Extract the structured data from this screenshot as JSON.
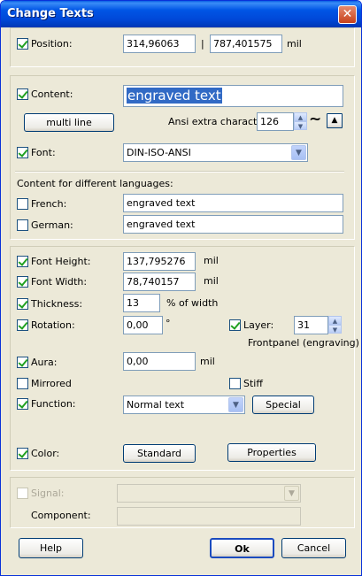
{
  "window": {
    "title": "Change Texts"
  },
  "position": {
    "label": "Position:",
    "x": "314,96063",
    "separator": "|",
    "y": "787,401575",
    "unit": "mil"
  },
  "content": {
    "label": "Content:",
    "value": "engraved text",
    "multiline_label": "multi line",
    "ansi_label": "Ansi extra character:",
    "ansi_value": "126",
    "tilde": "~",
    "font_label": "Font:",
    "font_value": "DIN-ISO-ANSI",
    "languages_label": "Content for different languages:",
    "french_label": "French:",
    "french_value": "engraved text",
    "german_label": "German:",
    "german_value": "engraved text"
  },
  "format": {
    "font_height_label": "Font Height:",
    "font_height": "137,795276",
    "font_height_unit": "mil",
    "font_width_label": "Font Width:",
    "font_width": "78,740157",
    "font_width_unit": "mil",
    "thickness_label": "Thickness:",
    "thickness": "13",
    "thickness_unit": "% of width",
    "rotation_label": "Rotation:",
    "rotation": "0,00",
    "rotation_unit": "°",
    "layer_label": "Layer:",
    "layer_value": "31",
    "layer_desc": "Frontpanel (engraving)",
    "aura_label": "Aura:",
    "aura": "0,00",
    "aura_unit": "mil",
    "mirrored_label": "Mirrored",
    "stiff_label": "Stiff",
    "function_label": "Function:",
    "function_value": "Normal text",
    "special_label": "Special",
    "color_label": "Color:",
    "color_button": "Standard",
    "properties_label": "Properties"
  },
  "signal": {
    "label": "Signal:",
    "value": "",
    "component_label": "Component:",
    "component_value": ""
  },
  "footer": {
    "help": "Help",
    "ok": "Ok",
    "cancel": "Cancel"
  }
}
